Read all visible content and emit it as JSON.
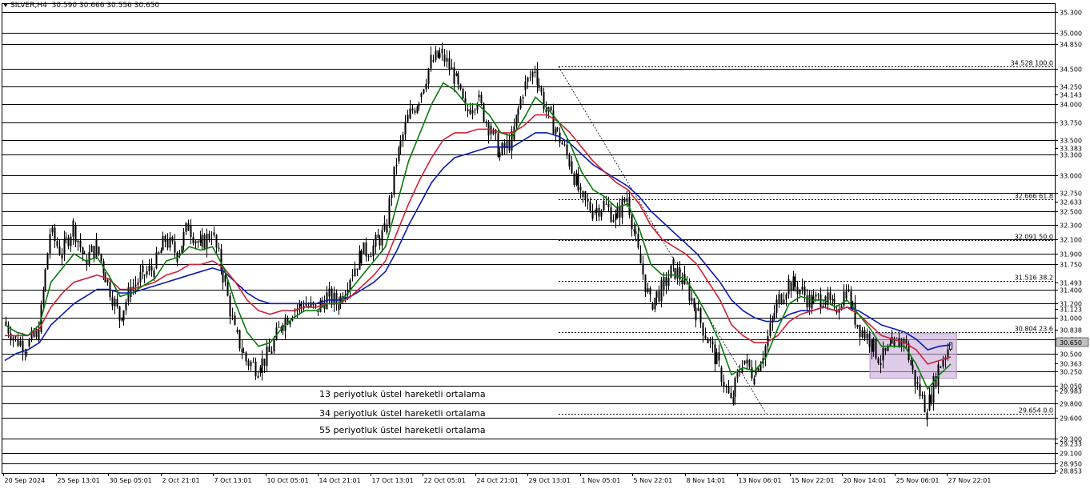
{
  "header": {
    "symbol": "SILVER,H4",
    "ohlc": "30.590 30.666 30.556 30.650"
  },
  "colors": {
    "ema13": "#0a7a0a",
    "ema34": "#d0203a",
    "ema55": "#0a1ab0",
    "box": "#c8a8d8",
    "grid": "#000000"
  },
  "legend": [
    {
      "label": "13 periyotluk üstel hareketli ortalama",
      "color": "#0a7a0a"
    },
    {
      "label": "34 periyotluk üstel hareketli ortalama",
      "color": "#d0203a"
    },
    {
      "label": "55 periyotluk üstel hareketli ortalama",
      "color": "#0a1ab0"
    }
  ],
  "chart_data": {
    "type": "line",
    "instrument": "SILVER",
    "timeframe": "H4",
    "ylim": [
      28.82,
      35.42
    ],
    "price_axis_labels": [
      "35.300",
      "35.000",
      "34.850",
      "34.500",
      "34.250",
      "34.143",
      "34.000",
      "33.750",
      "33.500",
      "33.383",
      "33.300",
      "33.000",
      "32.750",
      "32.633",
      "32.500",
      "32.300",
      "32.100",
      "31.900",
      "31.750",
      "31.493",
      "31.400",
      "31.200",
      "31.123",
      "31.000",
      "30.838",
      "30.700",
      "30.500",
      "30.363",
      "30.250",
      "30.050",
      "29.983",
      "29.800",
      "29.600",
      "29.233",
      "29.300",
      "29.100",
      "28.950",
      "28.853"
    ],
    "horizontal_levels": [
      35.3,
      35.0,
      34.85,
      34.5,
      34.25,
      34.0,
      33.75,
      33.5,
      33.3,
      33.0,
      32.75,
      32.5,
      32.3,
      32.1,
      31.9,
      31.75,
      31.4,
      31.2,
      31.0,
      30.7,
      30.5,
      30.25,
      30.05,
      29.8,
      29.6,
      29.3,
      29.1,
      28.95
    ],
    "fibonacci": {
      "high": 34.528,
      "low": 29.654,
      "levels": [
        {
          "price": 34.528,
          "label": "34.528 100.0"
        },
        {
          "price": 32.666,
          "label": "32.666 61.8"
        },
        {
          "price": 32.091,
          "label": "32.091 50.0"
        },
        {
          "price": 31.516,
          "label": "31.516 38.2"
        },
        {
          "price": 30.804,
          "label": "30.804 23.6"
        },
        {
          "price": 29.654,
          "label": "29.654 0.0"
        }
      ]
    },
    "time_labels": [
      "20 Sep 2024",
      "25 Sep 13:01",
      "30 Sep 05:01",
      "2 Oct 21:01",
      "7 Oct 13:01",
      "10 Oct 05:01",
      "14 Oct 21:01",
      "17 Oct 13:01",
      "22 Oct 05:01",
      "24 Oct 21:01",
      "29 Oct 13:01",
      "1 Nov 05:01",
      "5 Nov 22:01",
      "8 Nov 14:01",
      "13 Nov 06:01",
      "15 Nov 22:01",
      "20 Nov 14:01",
      "25 Nov 06:01",
      "27 Nov 22:01"
    ],
    "price_path": [
      30.95,
      30.7,
      30.6,
      30.8,
      32.2,
      31.9,
      32.3,
      31.8,
      32.0,
      31.5,
      31.0,
      31.4,
      31.6,
      31.7,
      32.1,
      31.9,
      32.3,
      32.0,
      32.2,
      31.6,
      30.8,
      30.4,
      30.3,
      30.5,
      30.9,
      31.1,
      31.2,
      31.1,
      31.3,
      31.2,
      31.6,
      31.9,
      32.0,
      32.2,
      33.2,
      33.8,
      34.1,
      34.6,
      34.7,
      34.4,
      33.9,
      34.1,
      33.7,
      33.3,
      33.5,
      34.2,
      34.5,
      33.9,
      33.6,
      33.2,
      32.7,
      32.5,
      32.6,
      32.4,
      32.7,
      31.9,
      31.2,
      31.4,
      31.7,
      31.5,
      31.1,
      30.7,
      30.3,
      29.8,
      30.4,
      30.2,
      30.6,
      31.2,
      31.5,
      31.4,
      31.2,
      31.3,
      31.1,
      31.4,
      30.9,
      30.7,
      30.4,
      30.6,
      30.7,
      30.1,
      29.7,
      30.3,
      30.65
    ],
    "ema13": [
      30.9,
      30.8,
      30.75,
      30.9,
      31.5,
      31.7,
      31.9,
      31.8,
      31.85,
      31.6,
      31.3,
      31.35,
      31.45,
      31.55,
      31.8,
      31.85,
      32.0,
      31.95,
      32.0,
      31.7,
      31.2,
      30.8,
      30.6,
      30.65,
      30.85,
      31.0,
      31.1,
      31.1,
      31.2,
      31.2,
      31.4,
      31.6,
      31.8,
      32.0,
      32.6,
      33.2,
      33.6,
      34.0,
      34.3,
      34.2,
      34.0,
      34.0,
      33.85,
      33.6,
      33.55,
      33.8,
      34.1,
      33.95,
      33.75,
      33.45,
      33.05,
      32.8,
      32.7,
      32.55,
      32.6,
      32.25,
      31.75,
      31.6,
      31.6,
      31.55,
      31.3,
      31.0,
      30.65,
      30.2,
      30.3,
      30.25,
      30.45,
      30.85,
      31.2,
      31.3,
      31.25,
      31.25,
      31.15,
      31.25,
      31.05,
      30.85,
      30.6,
      30.6,
      30.6,
      30.35,
      30.0,
      30.2,
      30.35
    ],
    "ema34": [
      30.75,
      30.75,
      30.75,
      30.85,
      31.15,
      31.35,
      31.5,
      31.55,
      31.6,
      31.55,
      31.4,
      31.4,
      31.45,
      31.5,
      31.6,
      31.65,
      31.75,
      31.75,
      31.8,
      31.7,
      31.5,
      31.25,
      31.1,
      31.05,
      31.1,
      31.1,
      31.15,
      31.15,
      31.2,
      31.2,
      31.3,
      31.45,
      31.6,
      31.8,
      32.2,
      32.6,
      32.95,
      33.25,
      33.5,
      33.6,
      33.6,
      33.65,
      33.65,
      33.6,
      33.6,
      33.7,
      33.85,
      33.85,
      33.75,
      33.6,
      33.4,
      33.2,
      33.05,
      32.9,
      32.8,
      32.6,
      32.3,
      32.1,
      32.0,
      31.9,
      31.75,
      31.5,
      31.25,
      30.9,
      30.75,
      30.65,
      30.65,
      30.75,
      30.95,
      31.05,
      31.1,
      31.15,
      31.1,
      31.15,
      31.05,
      30.9,
      30.75,
      30.7,
      30.65,
      30.55,
      30.35,
      30.4,
      30.45
    ],
    "ema55": [
      30.4,
      30.5,
      30.55,
      30.65,
      30.9,
      31.05,
      31.2,
      31.3,
      31.4,
      31.4,
      31.35,
      31.35,
      31.4,
      31.45,
      31.5,
      31.55,
      31.6,
      31.65,
      31.7,
      31.65,
      31.5,
      31.35,
      31.25,
      31.2,
      31.2,
      31.2,
      31.2,
      31.2,
      31.25,
      31.25,
      31.3,
      31.4,
      31.5,
      31.65,
      31.95,
      32.3,
      32.6,
      32.9,
      33.1,
      33.25,
      33.3,
      33.35,
      33.4,
      33.4,
      33.4,
      33.5,
      33.6,
      33.6,
      33.55,
      33.45,
      33.3,
      33.15,
      33.05,
      32.95,
      32.85,
      32.7,
      32.5,
      32.35,
      32.2,
      32.05,
      31.9,
      31.7,
      31.5,
      31.25,
      31.1,
      31.0,
      30.95,
      30.95,
      31.05,
      31.1,
      31.1,
      31.15,
      31.1,
      31.15,
      31.1,
      31.0,
      30.9,
      30.85,
      30.8,
      30.7,
      30.55,
      30.6,
      30.62
    ],
    "highlight_box": {
      "x_start": 75,
      "x_end": 82.5,
      "price_top": 30.78,
      "price_bottom": 30.15
    },
    "current_price": 30.65
  }
}
